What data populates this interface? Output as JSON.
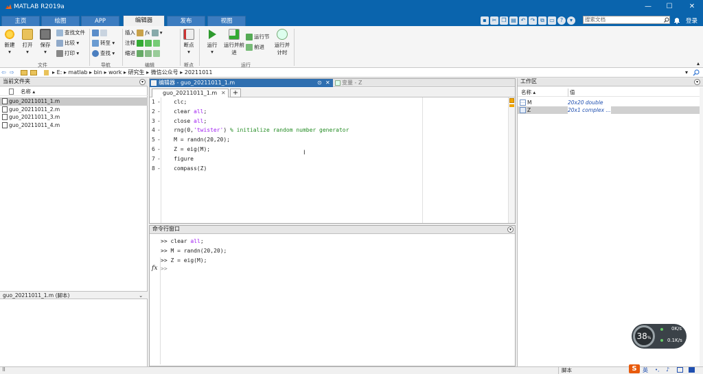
{
  "window": {
    "title": "MATLAB R2019a",
    "minimize": "—",
    "maximize": "☐",
    "close": "✕"
  },
  "ribbon_tabs": [
    {
      "label": "主页"
    },
    {
      "label": "绘图"
    },
    {
      "label": "APP"
    },
    {
      "label": "编辑器"
    },
    {
      "label": "发布"
    },
    {
      "label": "视图"
    }
  ],
  "search_placeholder": "搜索文档",
  "login": "登录",
  "toolstrip": {
    "file": {
      "new": "新建",
      "open": "打开",
      "save": "保存",
      "find_files": "查找文件",
      "compare": "比较",
      "print": "打印",
      "section": "文件"
    },
    "nav": {
      "goto": "转至",
      "find": "查找",
      "section": "导航"
    },
    "edit": {
      "insert": "插入",
      "comment": "注释",
      "indent": "缩进",
      "fx": "fx",
      "section": "编辑"
    },
    "breakpoints": {
      "label": "断点",
      "section": "断点"
    },
    "run": {
      "run": "运行",
      "run_advance": "运行并前进",
      "run_section": "运行节",
      "advance": "前进",
      "run_time": "运行并计时",
      "section": "运行"
    }
  },
  "address": {
    "parts": [
      "E:",
      "matlab",
      "bin",
      "work",
      "研究生",
      "微信公众号",
      "20211011"
    ]
  },
  "current_folder": {
    "title": "当前文件夹",
    "col_name": "名称 ▴",
    "files": [
      "guo_20211011_1.m",
      "guo_20211011_2.m",
      "guo_20211011_3.m",
      "guo_20211011_4.m"
    ],
    "details": "guo_20211011_1.m  (脚本)"
  },
  "editor": {
    "title": "编辑器 - guo_20211011_1.m",
    "var_tab": "变量 - Z",
    "file_tab": "guo_20211011_1.m",
    "add_tab": "+",
    "lines": [
      {
        "n": "1",
        "parts": [
          {
            "t": "    clc;",
            "c": "kw"
          }
        ]
      },
      {
        "n": "2",
        "parts": [
          {
            "t": "    clear ",
            "c": "kw"
          },
          {
            "t": "all",
            "c": "str"
          },
          {
            "t": ";",
            "c": "kw"
          }
        ]
      },
      {
        "n": "3",
        "parts": [
          {
            "t": "    close ",
            "c": "kw"
          },
          {
            "t": "all",
            "c": "str"
          },
          {
            "t": ";",
            "c": "kw"
          }
        ]
      },
      {
        "n": "4",
        "parts": [
          {
            "t": "    rng(0,",
            "c": "kw"
          },
          {
            "t": "'twister'",
            "c": "str"
          },
          {
            "t": ") ",
            "c": "kw"
          },
          {
            "t": "% initialize random number generator",
            "c": "cmt"
          }
        ]
      },
      {
        "n": "5",
        "parts": [
          {
            "t": "    M = randn(20,20);",
            "c": "kw"
          }
        ]
      },
      {
        "n": "6",
        "parts": [
          {
            "t": "    Z = eig(M);",
            "c": "kw"
          }
        ]
      },
      {
        "n": "7",
        "parts": [
          {
            "t": "    figure",
            "c": "kw"
          }
        ]
      },
      {
        "n": "8",
        "parts": [
          {
            "t": "    compass(Z)",
            "c": "kw"
          }
        ]
      }
    ]
  },
  "command_window": {
    "title": "命令行窗口",
    "lines": [
      {
        "parts": [
          {
            "t": ">> clear ",
            "c": "kw"
          },
          {
            "t": "all",
            "c": "str"
          },
          {
            "t": ";",
            "c": "kw"
          }
        ]
      },
      {
        "parts": [
          {
            "t": ">> M = randn(20,20);",
            "c": "kw"
          }
        ]
      },
      {
        "parts": [
          {
            "t": ">> Z = eig(M);",
            "c": "kw"
          }
        ]
      }
    ],
    "prompt": ">>",
    "fx": "fx"
  },
  "workspace": {
    "title": "工作区",
    "col_name": "名称 ▴",
    "col_value": "值",
    "vars": [
      {
        "name": "M",
        "value": "20x20 double"
      },
      {
        "name": "Z",
        "value": "20x1 complex ..."
      }
    ]
  },
  "status": {
    "mode": "脚本",
    "ime": "英"
  },
  "netmon": {
    "percent": "38",
    "unit": "%",
    "up": "0K/s",
    "down": "0.1K/s"
  },
  "colors": {
    "title_blue": "#0a64ad",
    "accent_orange": "#f26b21",
    "green": "#2e9a2e"
  }
}
